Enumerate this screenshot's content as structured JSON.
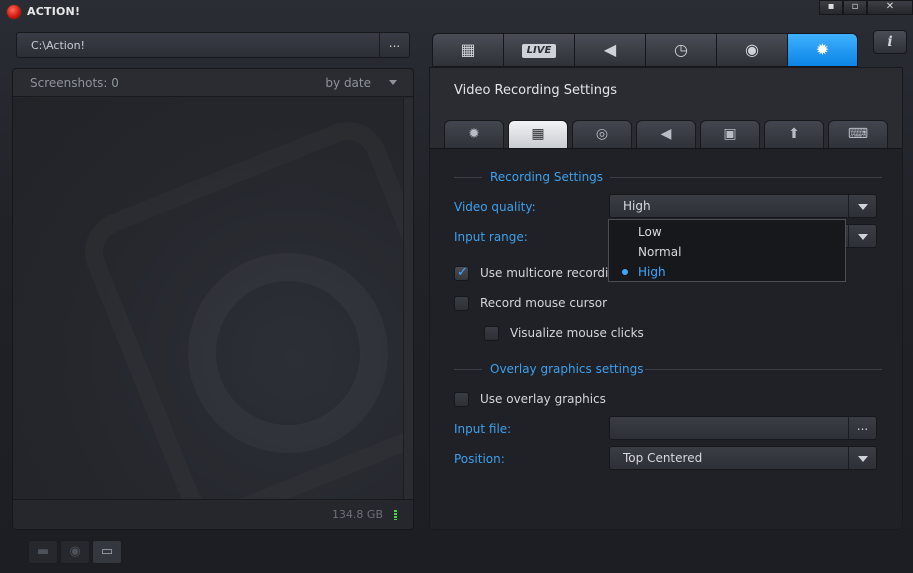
{
  "window": {
    "title": "ACTION!",
    "minimize_label": "▪",
    "maximize_label": "▫",
    "close_label": "✕"
  },
  "left": {
    "path": "C:\\Action!",
    "browse_label": "...",
    "screenshots_label": "Screenshots: 0",
    "sort_label": "by date",
    "disk_free": "134.8 GB"
  },
  "top_tabs": [
    {
      "name": "video-tab",
      "icon": "film-icon",
      "glyph": "▦",
      "active": false
    },
    {
      "name": "live-tab",
      "icon": "live-icon",
      "label": "LIVE",
      "active": false
    },
    {
      "name": "audio-tab",
      "icon": "speaker-icon",
      "glyph": "◀",
      "active": false
    },
    {
      "name": "benchmark-tab",
      "icon": "stopwatch-icon",
      "glyph": "◷",
      "active": false
    },
    {
      "name": "screenshot-tab",
      "icon": "camera-icon",
      "glyph": "◉",
      "active": false
    },
    {
      "name": "settings-tab",
      "icon": "gear-icon",
      "glyph": "✹",
      "active": true
    }
  ],
  "info_label": "i",
  "panel": {
    "title": "Video Recording Settings",
    "sub_tabs": [
      {
        "name": "general",
        "icon": "gear-icon",
        "glyph": "✹",
        "active": false
      },
      {
        "name": "video",
        "icon": "film-icon",
        "glyph": "▦",
        "active": true
      },
      {
        "name": "webcam",
        "icon": "webcam-icon",
        "glyph": "◎",
        "active": false
      },
      {
        "name": "audio",
        "icon": "speaker-icon",
        "glyph": "◀",
        "active": false
      },
      {
        "name": "monitor",
        "icon": "monitor-icon",
        "glyph": "▣",
        "active": false
      },
      {
        "name": "upload",
        "icon": "upload-icon",
        "glyph": "⬆",
        "active": false
      },
      {
        "name": "keyboard",
        "icon": "keyboard-icon",
        "glyph": "⌨",
        "active": false
      }
    ],
    "recording_group": "Recording Settings",
    "video_quality_label": "Video quality:",
    "video_quality_value": "High",
    "input_range_label": "Input range:",
    "multicore_label": "Use multicore recordin",
    "mouse_cursor_label": "Record mouse cursor",
    "mouse_clicks_label": "Visualize mouse clicks",
    "overlay_group": "Overlay graphics settings",
    "use_overlay_label": "Use overlay graphics",
    "input_file_label": "Input file:",
    "input_file_value": "",
    "input_file_browse": "...",
    "position_label": "Position:",
    "position_value": "Top Centered"
  },
  "quality_options": [
    "Low",
    "Normal",
    "High"
  ],
  "quality_selected": "High",
  "colors": {
    "accent": "#3ea0ec",
    "active_tab": "#1a94f2",
    "record_red": "#d0140c",
    "disk_indicator": "#4cd14a"
  }
}
